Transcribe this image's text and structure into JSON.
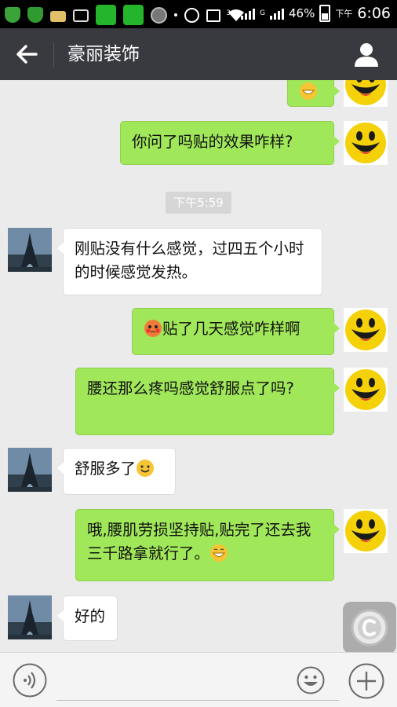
{
  "status_bar": {
    "network_3g": "3G",
    "network_g": "G",
    "battery": "46%",
    "am_pm": "下午",
    "time": "6:06"
  },
  "header": {
    "title": "豪丽装饰",
    "icons": {
      "back": "arrow-left-icon",
      "profile": "person-icon"
    }
  },
  "chat": {
    "messages": [
      {
        "side": "out",
        "text": "",
        "emoji": "grin-emoji"
      },
      {
        "side": "out",
        "text": "你问了吗贴的效果咋样?"
      },
      {
        "type": "time",
        "text": "下午5:59"
      },
      {
        "side": "in",
        "text": "刚贴没有什么感觉，过四五个小时的时候感觉发热。"
      },
      {
        "side": "out",
        "text": "贴了几天感觉咋样啊",
        "emoji": "blush-face-emoji"
      },
      {
        "side": "out",
        "text": "腰还那么疼吗感觉舒服点了吗?"
      },
      {
        "side": "in",
        "text": "舒服多了",
        "emoji": "smile-emoji"
      },
      {
        "side": "out",
        "text": "哦,腰肌劳损坚持贴,贴完了还去我三千路拿就行了。",
        "emoji": "grin-emoji"
      },
      {
        "side": "in",
        "text": "好的"
      }
    ]
  },
  "input_bar": {
    "placeholder": "",
    "icons": {
      "voice": "voice-icon",
      "emoji": "smiley-icon",
      "more": "plus-icon"
    }
  },
  "colors": {
    "header_bg": "#393a3f",
    "chat_bg": "#ebebeb",
    "out_bubble": "#a0e75a",
    "in_bubble": "#ffffff"
  }
}
